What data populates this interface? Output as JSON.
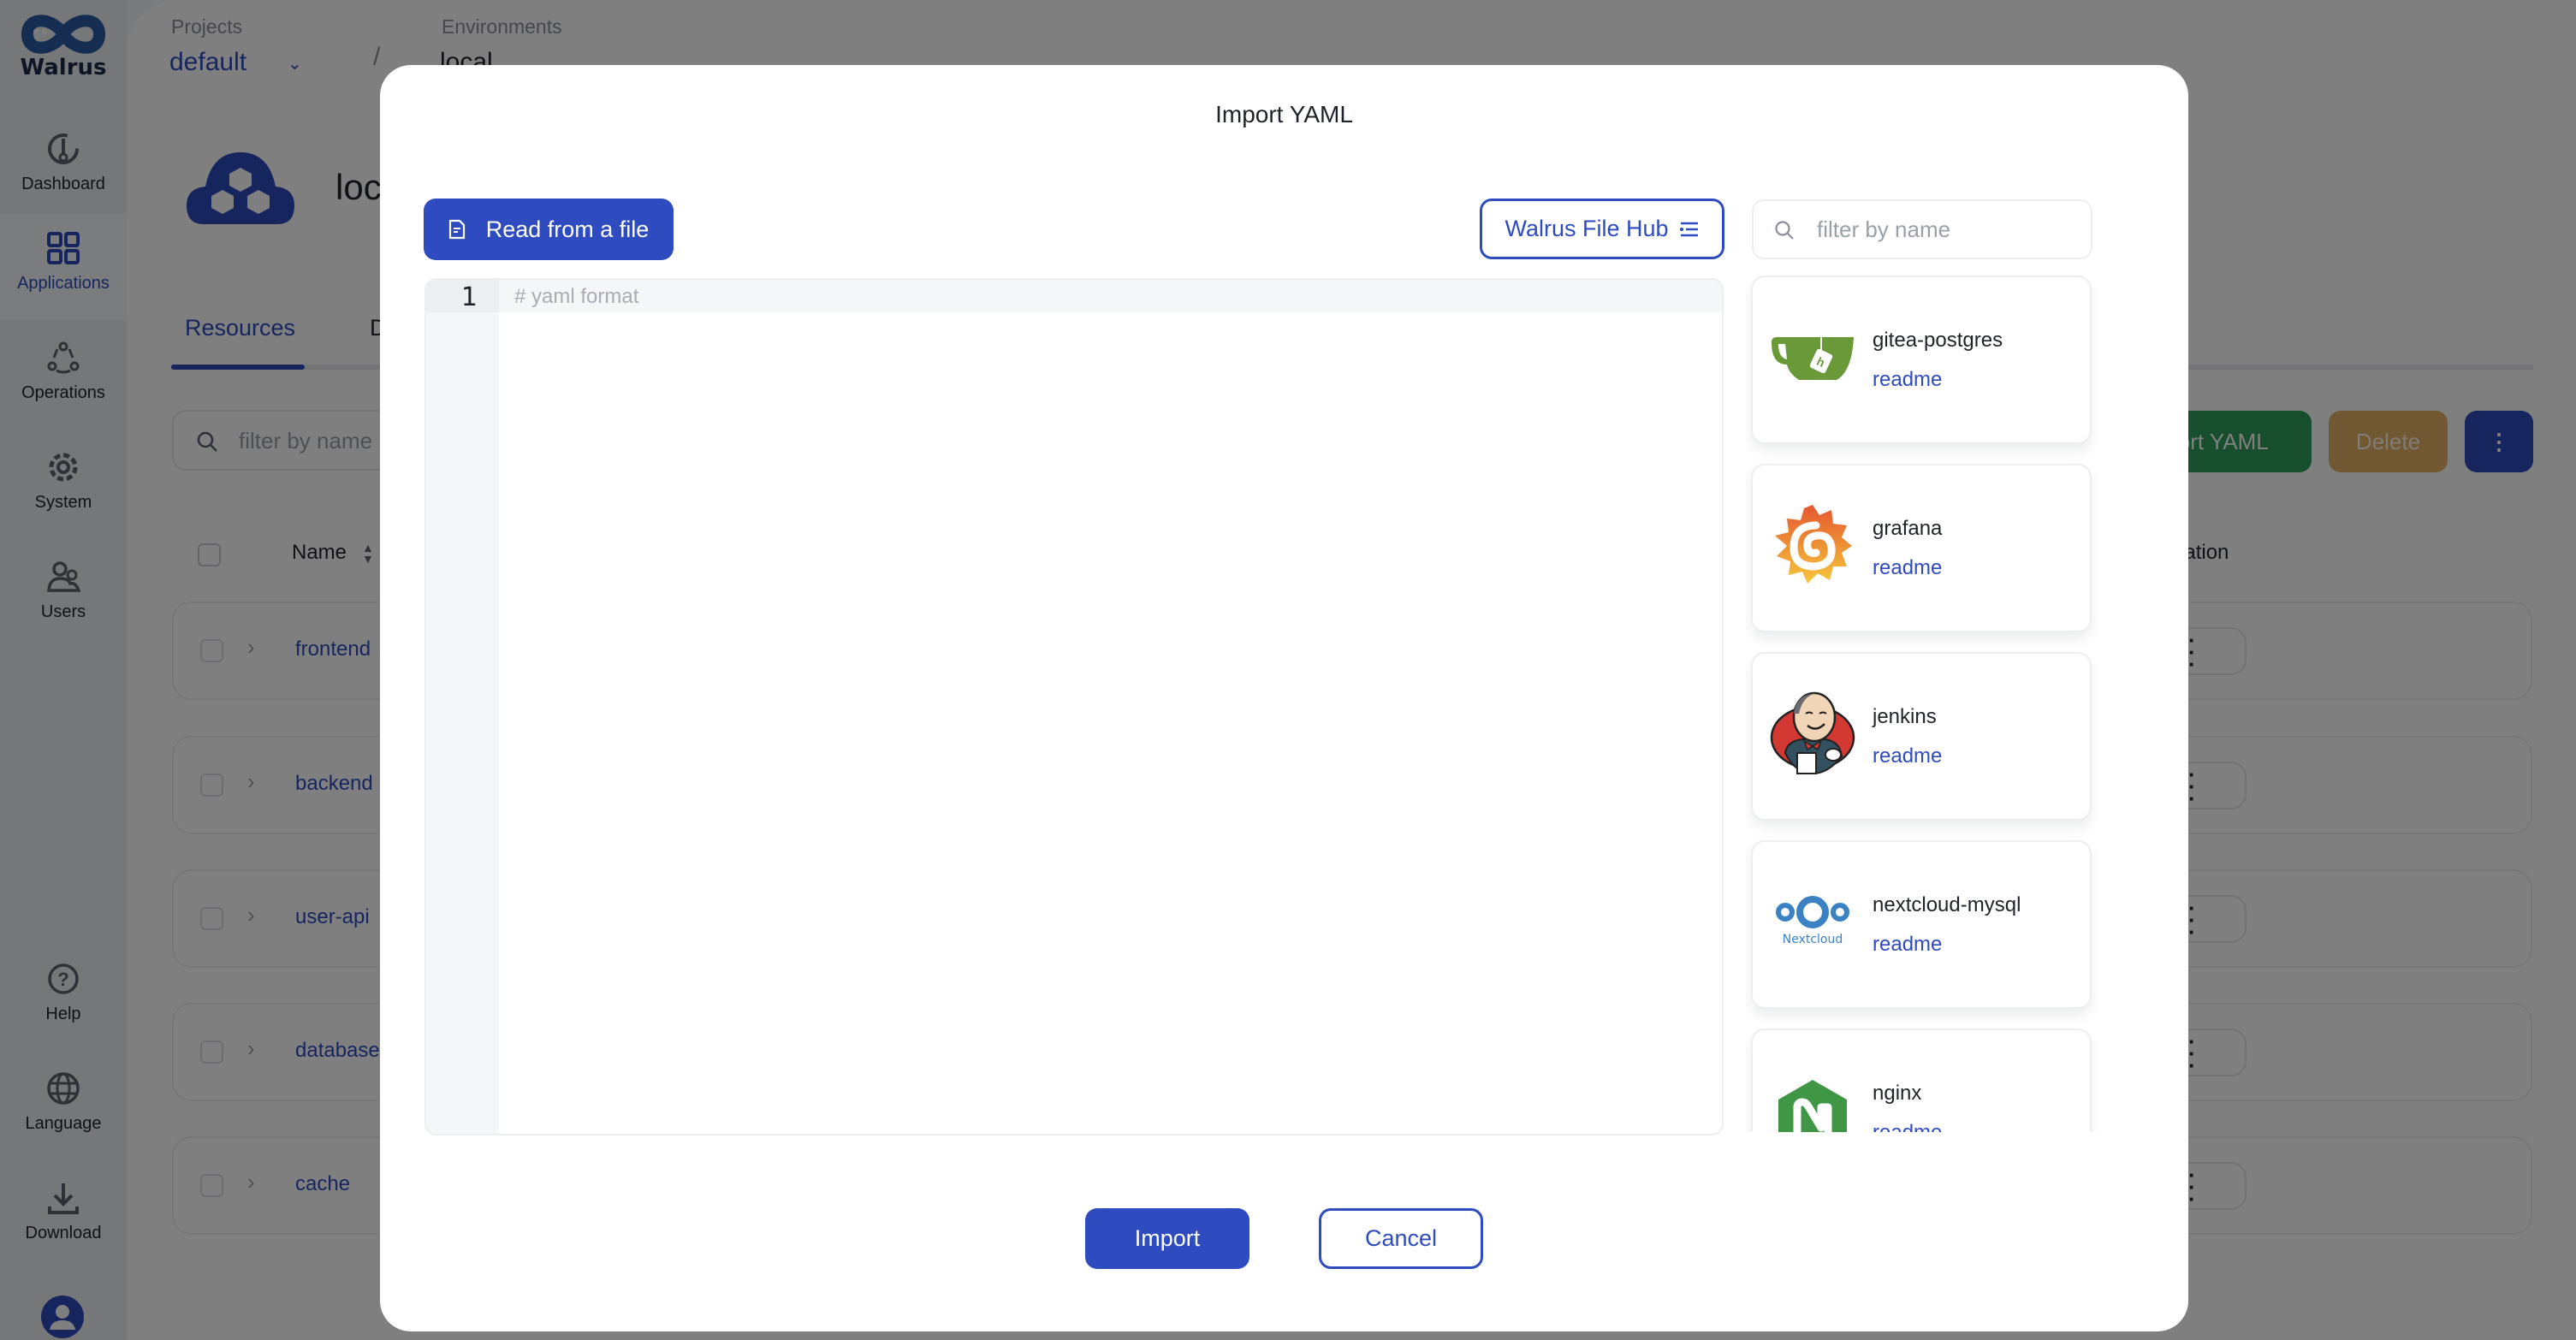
{
  "app": {
    "brand": "Walrus",
    "sidebar": {
      "items": [
        {
          "label": "Dashboard",
          "icon": "dashboard-icon"
        },
        {
          "label": "Applications",
          "icon": "applications-icon",
          "active": true
        },
        {
          "label": "Operations",
          "icon": "operations-icon"
        },
        {
          "label": "System",
          "icon": "gear-icon"
        },
        {
          "label": "Users",
          "icon": "users-icon"
        }
      ],
      "bottom_items": [
        {
          "label": "Help",
          "icon": "help-icon"
        },
        {
          "label": "Language",
          "icon": "globe-icon"
        },
        {
          "label": "Download",
          "icon": "download-icon"
        }
      ]
    },
    "breadcrumb": {
      "projects_label": "Projects",
      "project_value": "default",
      "separator": "/",
      "environments_label": "Environments",
      "environment_value": "local"
    },
    "environment_title": "loc",
    "tabs": [
      {
        "label": "Resources",
        "active": true
      },
      {
        "label": "D"
      }
    ],
    "search_placeholder": "filter by name",
    "toolbar": {
      "import_yaml_label": "Import YAML",
      "import_yaml_visible": "port YAML",
      "delete_label": "Delete",
      "more_label": "⋮"
    },
    "table": {
      "columns": {
        "name": "Name",
        "operation_visible": "eration"
      },
      "rows": [
        {
          "name": "frontend"
        },
        {
          "name": "backend"
        },
        {
          "name": "user-api"
        },
        {
          "name": "database"
        },
        {
          "name": "cache"
        }
      ]
    }
  },
  "modal": {
    "title": "Import YAML",
    "read_file_label": "Read from a file",
    "file_hub_label": "Walrus File Hub",
    "editor": {
      "line_number": "1",
      "placeholder": "# yaml format"
    },
    "hub_search_placeholder": "filter by name",
    "templates": [
      {
        "name": "gitea-postgres",
        "link": "readme",
        "logo": "gitea-logo"
      },
      {
        "name": "grafana",
        "link": "readme",
        "logo": "grafana-logo"
      },
      {
        "name": "jenkins",
        "link": "readme",
        "logo": "jenkins-logo"
      },
      {
        "name": "nextcloud-mysql",
        "link": "readme",
        "logo": "nextcloud-logo",
        "logo_caption": "Nextcloud"
      },
      {
        "name": "nginx",
        "link": "readme",
        "logo": "nginx-logo"
      }
    ],
    "import_label": "Import",
    "cancel_label": "Cancel"
  },
  "colors": {
    "primary": "#2E4BBF",
    "success": "#2F9C5A",
    "warning": "#E3B067",
    "overlay": "rgba(0,0,0,0.5)"
  }
}
